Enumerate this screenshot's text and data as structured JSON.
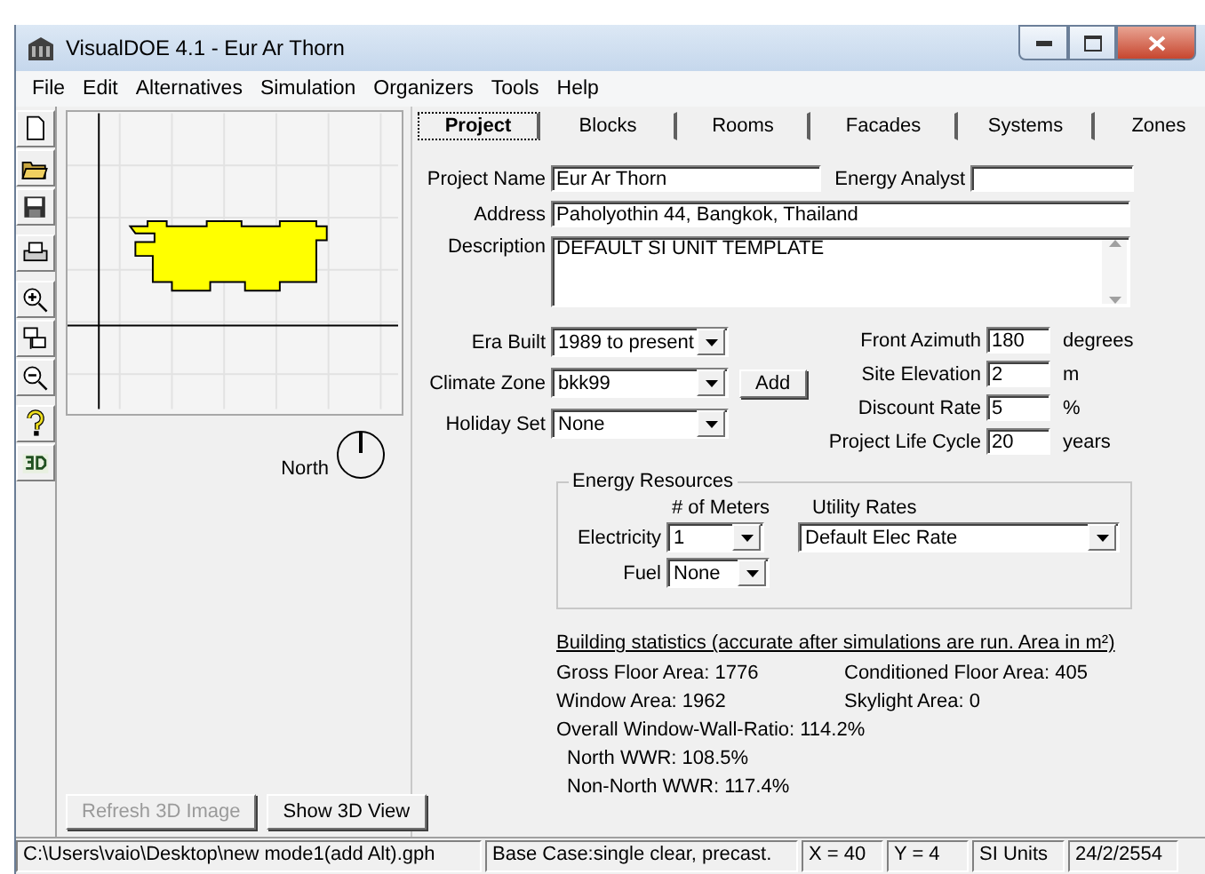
{
  "window": {
    "title": "VisualDOE 4.1 - Eur Ar Thorn"
  },
  "menu": [
    "File",
    "Edit",
    "Alternatives",
    "Simulation",
    "Organizers",
    "Tools",
    "Help"
  ],
  "tabs": [
    {
      "label": "Project",
      "selected": true
    },
    {
      "label": "Blocks",
      "selected": false
    },
    {
      "label": "Rooms",
      "selected": false
    },
    {
      "label": "Facades",
      "selected": false
    },
    {
      "label": "Systems",
      "selected": false
    },
    {
      "label": "Zones",
      "selected": false
    }
  ],
  "plan": {
    "north_label": "North"
  },
  "plan_buttons": [
    {
      "label": "Refresh 3D Image",
      "disabled": true
    },
    {
      "label": "Show 3D View",
      "disabled": false
    }
  ],
  "project_name": {
    "label": "Project Name",
    "value": "Eur Ar Thorn"
  },
  "energy_analyst": {
    "label": "Energy Analyst"
  },
  "address": {
    "label": "Address",
    "value": "Paholyothin 44, Bangkok, Thailand"
  },
  "description": {
    "label": "Description",
    "value": "DEFAULT SI UNIT TEMPLATE"
  },
  "selects": [
    {
      "label": "Era Built",
      "value": "1989 to present"
    },
    {
      "label": "Climate Zone",
      "value": "bkk99"
    },
    {
      "label": "Holiday Set",
      "value": "None"
    }
  ],
  "add_button": "Add",
  "numeric_fields": [
    {
      "label": "Front Azimuth",
      "value": "180",
      "unit": "degrees"
    },
    {
      "label": "Site Elevation",
      "value": "2",
      "unit": "m"
    },
    {
      "label": "Discount Rate",
      "value": "5",
      "unit": "%"
    },
    {
      "label": "Project Life Cycle",
      "value": "20",
      "unit": "years"
    }
  ],
  "energy_resources": {
    "title": "Energy Resources",
    "meters_header": "# of Meters",
    "rates_header": "Utility Rates",
    "rows": [
      {
        "label": "Electricity",
        "meters": "1",
        "rate": "Default Elec Rate"
      },
      {
        "label": "Fuel",
        "meters": "None"
      }
    ]
  },
  "building_statistics": {
    "heading": "Building statistics (accurate after simulations are run. Area in m²)",
    "gross_floor_area": "Gross Floor Area: 1776",
    "conditioned_floor_area": "Conditioned Floor Area: 405",
    "window_area": "Window Area: 1962",
    "skylight_area": "Skylight Area: 0",
    "wwr": [
      "Overall Window-Wall-Ratio: 114.2%",
      "North WWR: 108.5%",
      "Non-North WWR: 117.4%"
    ]
  },
  "status_bar": [
    "C:\\Users\\vaio\\Desktop\\new mode1(add Alt).gph",
    "Base Case:single clear, precast.",
    "X = 40",
    "Y = 4",
    "SI Units",
    "24/2/2554"
  ]
}
